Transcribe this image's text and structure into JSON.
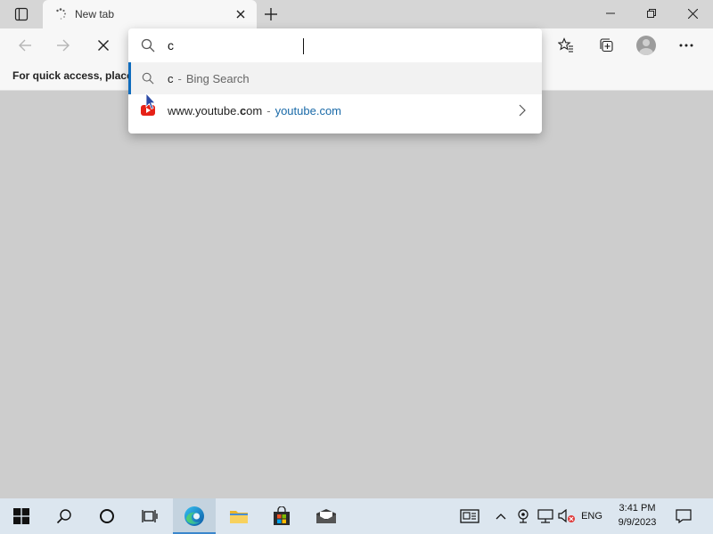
{
  "tab": {
    "title": "New tab"
  },
  "favorites_bar": {
    "hint": "For quick access, place y"
  },
  "omnibox": {
    "value": "c",
    "suggestions": [
      {
        "query": "c",
        "separator": "-",
        "provider": "Bing Search",
        "icon": "search-icon"
      },
      {
        "url_prefix": "www.youtube.",
        "url_bold": "c",
        "url_suffix": "om",
        "separator": "-",
        "domain": "youtube.com",
        "icon": "youtube-favicon"
      }
    ]
  },
  "taskbar": {
    "language": "ENG",
    "time": "3:41 PM",
    "date": "9/9/2023"
  },
  "colors": {
    "accent": "#0f6cbd",
    "taskbar": "#dce6ef",
    "content": "#cdcdcd"
  }
}
